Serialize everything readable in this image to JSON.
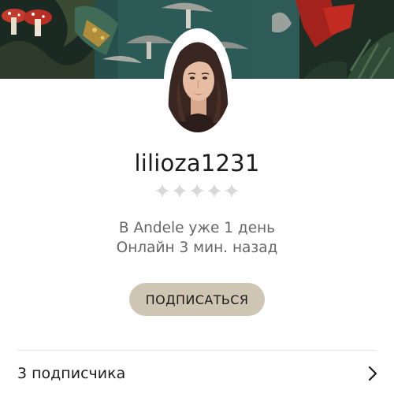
{
  "profile": {
    "username": "lilioza1231",
    "rating_stars": 5,
    "rating_filled": 0,
    "member_since": "В Andele уже 1 день",
    "online_status": "Онлайн 3 мин. назад"
  },
  "actions": {
    "subscribe_label": "ПОДПИСАТЬСЯ"
  },
  "followers": {
    "label": "3 подписчика"
  },
  "colors": {
    "button_bg": "#cec5b3",
    "star_empty": "#d9d9d9",
    "text_primary": "#1c1c1c",
    "text_secondary": "#666666"
  }
}
